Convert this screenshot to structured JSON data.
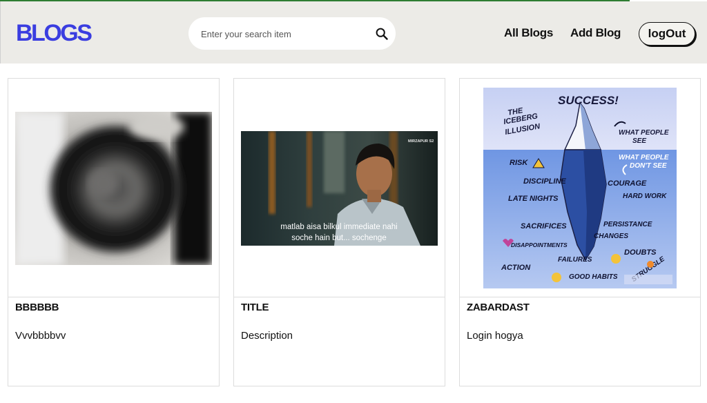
{
  "header": {
    "logo": "BLOGS",
    "search": {
      "placeholder": "Enter your search item",
      "icon": "search-icon"
    },
    "nav": {
      "all_blogs": "All Blogs",
      "add_blog": "Add Blog",
      "logout": "logOut"
    },
    "colors": {
      "logo": "#3a3de0",
      "header_bg": "#ecebe7"
    }
  },
  "blogs": [
    {
      "title": "BBBBBB",
      "description": "Vvvbbbbvv"
    },
    {
      "title": "TITLE",
      "description": "Description",
      "image_caption": [
        "matlab aisa bilkul immediate nahi",
        "soche hain but... sochenge"
      ],
      "image_badge": "MIRZAPUR S2"
    },
    {
      "title": "ZABARDAST",
      "description": "Login hogya",
      "image_text": {
        "heading": "SUCCESS!",
        "left_title": [
          "THE",
          "ICEBERG",
          "ILLUSION"
        ],
        "see": [
          "WHAT PEOPLE",
          "SEE"
        ],
        "dont_see": [
          "WHAT PEOPLE",
          "DON'T SEE"
        ],
        "left_items": [
          "RISK",
          "DISCIPLINE",
          "LATE NIGHTS",
          "SACRIFICES",
          "DISAPPOINTMENTS",
          "ACTION"
        ],
        "right_items": [
          "COURAGE",
          "HARD WORK",
          "PERSISTANCE",
          "CHANGES",
          "DOUBTS",
          "STRUGGLE"
        ],
        "bottom_items": [
          "FAILURES",
          "GOOD HABITS"
        ]
      }
    }
  ]
}
